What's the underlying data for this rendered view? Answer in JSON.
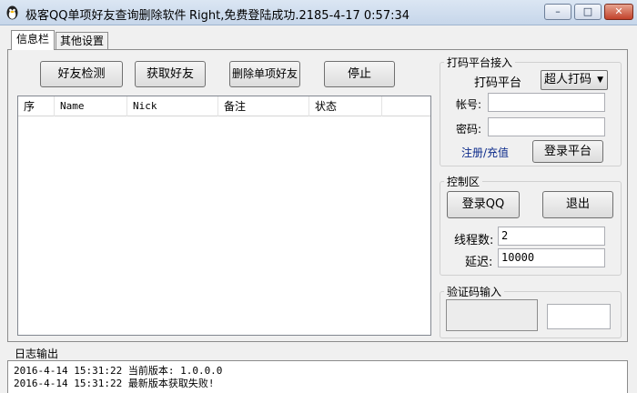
{
  "window": {
    "title": "极客QQ单项好友查询删除软件",
    "status": "Right,免费登陆成功.2185-4-17 0:57:34",
    "minimize_glyph": "–",
    "maximize_glyph": "□",
    "close_glyph": "✕"
  },
  "tabs": [
    {
      "label": "信息栏"
    },
    {
      "label": "其他设置"
    }
  ],
  "actions": {
    "friend_check": "好友检测",
    "get_friends": "获取好友",
    "delete_single": "删除单项好友",
    "stop": "停止"
  },
  "table": {
    "columns": [
      "序",
      "Name",
      "Nick",
      "备注",
      "状态"
    ],
    "rows": []
  },
  "captcha_platform": {
    "group_label": "打码平台接入",
    "platform_label": "打码平台",
    "platform_value": "超人打码",
    "account_label": "帐号:",
    "account_value": "",
    "password_label": "密码:",
    "password_value": "",
    "register_link": "注册/充值",
    "login_button": "登录平台"
  },
  "control": {
    "group_label": "控制区",
    "login_qq": "登录QQ",
    "exit": "退出",
    "threads_label": "线程数:",
    "threads_value": "2",
    "delay_label": "延迟:",
    "delay_value": "10000"
  },
  "captcha_input": {
    "group_label": "验证码输入",
    "code_value": ""
  },
  "log": {
    "label": "日志输出",
    "lines": [
      "2016-4-14 15:31:22 当前版本: 1.0.0.0",
      "2016-4-14 15:31:22 最新版本获取失败!"
    ]
  },
  "colors": {
    "link": "#0b2a8a",
    "close_button": "#c2422b",
    "window_bg": "#f0f0f0"
  }
}
